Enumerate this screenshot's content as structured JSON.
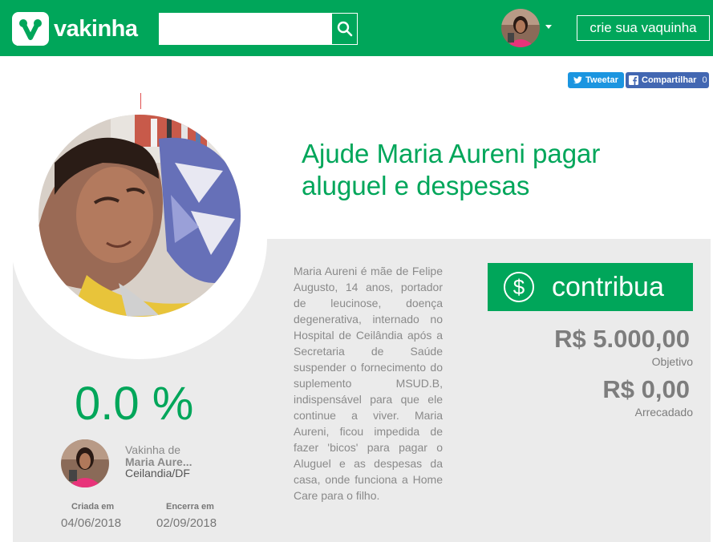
{
  "header": {
    "logo_text": "vakinha",
    "search": {
      "placeholder": "",
      "value": ""
    },
    "create_button": "crie sua vaquinha"
  },
  "share": {
    "tweet_label": "Tweetar",
    "facebook_label": "Compartilhar",
    "facebook_count": "0"
  },
  "campaign": {
    "title": "Ajude Maria Aureni pagar aluguel e despesas",
    "description": "Maria Aureni é mãe de Felipe Augusto, 14 anos, portador de leucinose, doença degenerativa, internado no Hospital de Ceilândia após a Secretaria de Saúde suspender o fornecimento do suplemento MSUD.B, indispensável para que ele continue a viver. Maria Aureni, ficou impedida de fazer 'bicos' para pagar o Aluguel e as despesas da casa, onde funciona a Home Care para o filho.",
    "contribute_label": "contribua",
    "currency_symbol": "$",
    "goal_value": "R$ 5.000,00",
    "goal_label": "Objetivo",
    "raised_value": "R$ 0,00",
    "raised_label": "Arrecadado",
    "percent": "0.0 %",
    "owner_prefix": "Vakinha de",
    "owner_name": "Maria Aure...",
    "owner_location": "Ceilandia/DF",
    "created_label": "Criada em",
    "created_date": "04/06/2018",
    "ends_label": "Encerra em",
    "ends_date": "02/09/2018"
  },
  "colors": {
    "brand_green": "#00a65a",
    "panel_grey": "#ebebeb",
    "twitter_blue": "#1b95e0",
    "facebook_blue": "#4267b2"
  },
  "icons": [
    "vakinha-logo-icon",
    "search-icon",
    "chevron-down-icon",
    "twitter-icon",
    "facebook-icon",
    "dollar-icon"
  ]
}
